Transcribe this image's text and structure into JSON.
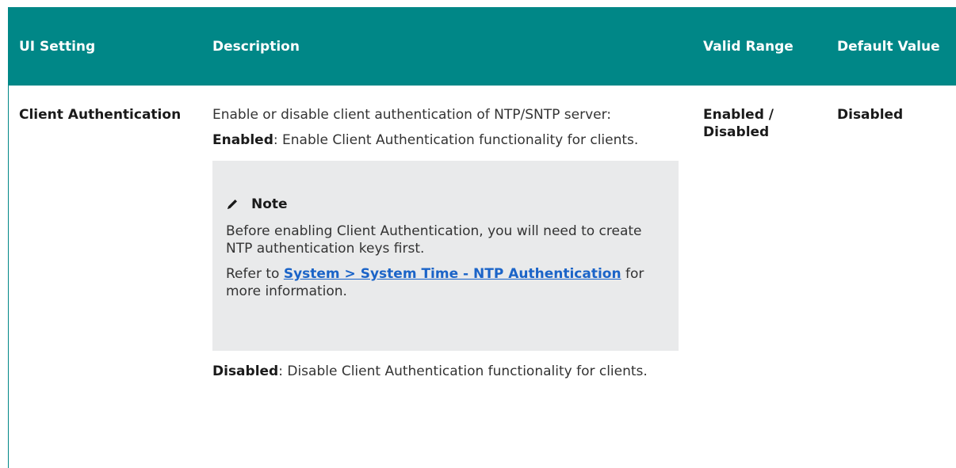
{
  "table": {
    "headers": {
      "setting": "UI Setting",
      "description": "Description",
      "valid_range": "Valid Range",
      "default_value": "Default Value"
    },
    "row": {
      "setting": "Client Authentication",
      "description_intro": "Enable or disable client authentication of NTP/SNTP server:",
      "enabled_term": "Enabled",
      "enabled_text": ": Enable Client Authentication functionality for clients.",
      "note": {
        "icon": "pencil-icon",
        "title": "Note",
        "body": "Before enabling Client Authentication, you will need to create NTP authentication keys first.",
        "refer_prefix": "Refer to ",
        "link_text": "System > System Time - NTP Authentication",
        "refer_suffix": " for more information."
      },
      "disabled_term": "Disabled",
      "disabled_text": ": Disable Client Authentication functionality for clients.",
      "valid_range": "Enabled / Disabled",
      "default_value": "Disabled"
    }
  },
  "colors": {
    "header_bg": "#008787",
    "header_text": "#ffffff",
    "note_bg": "#e9eaeb",
    "link": "#1b64c8"
  }
}
